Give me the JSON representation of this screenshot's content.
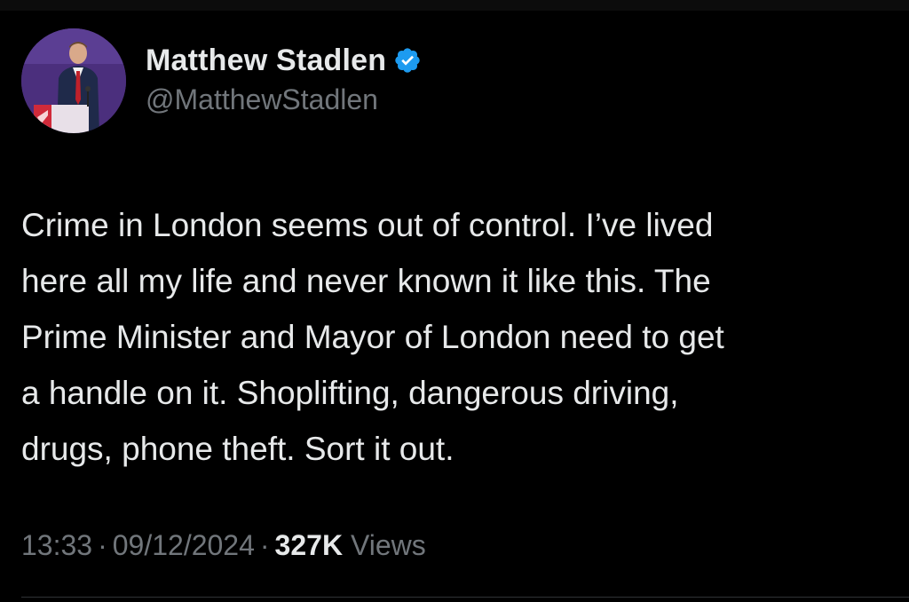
{
  "tweet": {
    "author": {
      "display_name": "Matthew Stadlen",
      "handle": "@MatthewStadlen",
      "verified": true,
      "verified_icon": "verified-badge-icon",
      "avatar_icon": "profile-photo"
    },
    "text": "Crime in London seems out of control. I’ve lived\nhere all my life and never known it like this. The\nPrime Minister and Mayor of London need to get\na handle on it. Shoplifting, dangerous driving,\ndrugs, phone theft. Sort it out.",
    "meta": {
      "time": "13:33",
      "separator": "·",
      "date": "09/12/2024",
      "views_count": "327K",
      "views_label": "Views"
    }
  },
  "colors": {
    "background": "#000000",
    "primary_text": "#e7e9ea",
    "secondary_text": "#71767b",
    "verified_blue": "#1d9bf0",
    "divider": "#2f3336"
  }
}
